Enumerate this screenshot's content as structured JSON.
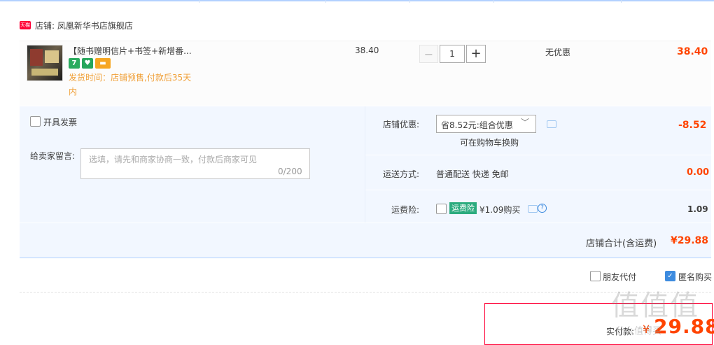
{
  "shop": {
    "badge": "天猫",
    "label": "店铺: 凤凰新华书店旗舰店"
  },
  "item": {
    "title": "【随书赠明信片+书签+新增番...",
    "services": [
      "7",
      "♥",
      "▬"
    ],
    "ship_time": "发货时间：店铺预售,付款后35天内",
    "unit_price": "38.40",
    "quantity": "1",
    "qty_minus": "−",
    "qty_plus": "+",
    "discount": "无优惠",
    "total": "38.40"
  },
  "invoice": {
    "label": "开具发票"
  },
  "message": {
    "label": "给卖家留言:",
    "placeholder": "选填，请先和商家协商一致，付款后商家可见",
    "counter": "0/200"
  },
  "coupon": {
    "label": "店铺优惠:",
    "selected": "省8.52元:组合优惠",
    "chevron": "﹀",
    "sub": "可在购物车换购",
    "amount": "-8.52"
  },
  "shipping": {
    "label": "运送方式:",
    "value": "普通配送 快递 免邮",
    "amount": "0.00"
  },
  "insurance": {
    "label": "运费险:",
    "badge": "运费险",
    "price": "¥1.09购买",
    "help": "?",
    "amount": "1.09"
  },
  "shop_total": {
    "label": "店铺合计(含运费)",
    "amount": "¥29.88"
  },
  "options": {
    "friend_pay": "朋友代付",
    "anonymous": "匿名购买",
    "anon_check": "✓"
  },
  "payment": {
    "label": "实付款:",
    "currency": "¥",
    "amount": "29.88"
  },
  "watermark": {
    "text": "值值值",
    "sub": "什么值得买"
  }
}
